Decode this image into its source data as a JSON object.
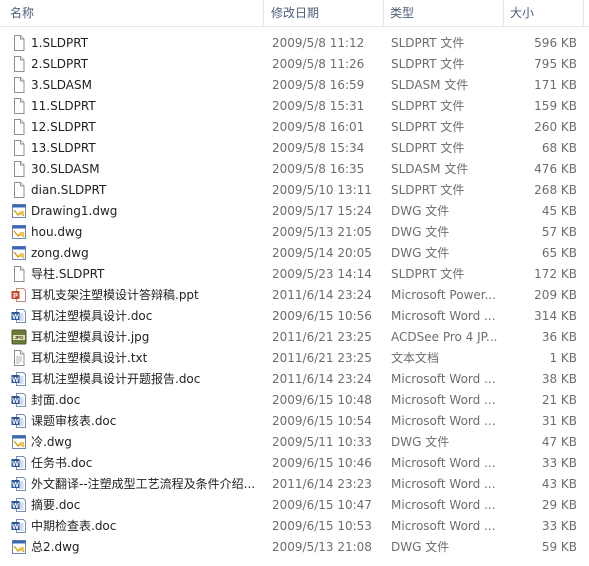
{
  "columns": {
    "name": "名称",
    "date": "修改日期",
    "type": "类型",
    "size": "大小"
  },
  "files": [
    {
      "name": "1.SLDPRT",
      "date": "2009/5/8 11:12",
      "type": "SLDPRT 文件",
      "size": "596 KB",
      "icon": "blank-file-icon"
    },
    {
      "name": "2.SLDPRT",
      "date": "2009/5/8 11:26",
      "type": "SLDPRT 文件",
      "size": "795 KB",
      "icon": "blank-file-icon"
    },
    {
      "name": "3.SLDASM",
      "date": "2009/5/8 16:59",
      "type": "SLDASM 文件",
      "size": "171 KB",
      "icon": "blank-file-icon"
    },
    {
      "name": "11.SLDPRT",
      "date": "2009/5/8 15:31",
      "type": "SLDPRT 文件",
      "size": "159 KB",
      "icon": "blank-file-icon"
    },
    {
      "name": "12.SLDPRT",
      "date": "2009/5/8 16:01",
      "type": "SLDPRT 文件",
      "size": "260 KB",
      "icon": "blank-file-icon"
    },
    {
      "name": "13.SLDPRT",
      "date": "2009/5/8 15:34",
      "type": "SLDPRT 文件",
      "size": "68 KB",
      "icon": "blank-file-icon"
    },
    {
      "name": "30.SLDASM",
      "date": "2009/5/8 16:35",
      "type": "SLDASM 文件",
      "size": "476 KB",
      "icon": "blank-file-icon"
    },
    {
      "name": "dian.SLDPRT",
      "date": "2009/5/10 13:11",
      "type": "SLDPRT 文件",
      "size": "268 KB",
      "icon": "blank-file-icon"
    },
    {
      "name": "Drawing1.dwg",
      "date": "2009/5/17 15:24",
      "type": "DWG 文件",
      "size": "45 KB",
      "icon": "dwg-file-icon"
    },
    {
      "name": "hou.dwg",
      "date": "2009/5/13 21:05",
      "type": "DWG 文件",
      "size": "57 KB",
      "icon": "dwg-file-icon"
    },
    {
      "name": "zong.dwg",
      "date": "2009/5/14 20:05",
      "type": "DWG 文件",
      "size": "65 KB",
      "icon": "dwg-file-icon"
    },
    {
      "name": "导柱.SLDPRT",
      "date": "2009/5/23 14:14",
      "type": "SLDPRT 文件",
      "size": "172 KB",
      "icon": "blank-file-icon"
    },
    {
      "name": "耳机支架注塑模设计答辩稿.ppt",
      "date": "2011/6/14 23:24",
      "type": "Microsoft Power...",
      "size": "209 KB",
      "icon": "ppt-file-icon"
    },
    {
      "name": "耳机注塑模具设计.doc",
      "date": "2009/6/15 10:56",
      "type": "Microsoft Word ...",
      "size": "314 KB",
      "icon": "word-file-icon"
    },
    {
      "name": "耳机注塑模具设计.jpg",
      "date": "2011/6/21 23:25",
      "type": "ACDSee Pro 4 JP...",
      "size": "36 KB",
      "icon": "jpg-file-icon"
    },
    {
      "name": "耳机注塑模具设计.txt",
      "date": "2011/6/21 23:25",
      "type": "文本文档",
      "size": "1 KB",
      "icon": "txt-file-icon"
    },
    {
      "name": "耳机注塑模具设计开题报告.doc",
      "date": "2011/6/14 23:24",
      "type": "Microsoft Word ...",
      "size": "38 KB",
      "icon": "word-file-icon"
    },
    {
      "name": "封面.doc",
      "date": "2009/6/15 10:48",
      "type": "Microsoft Word ...",
      "size": "21 KB",
      "icon": "word-file-icon"
    },
    {
      "name": "课题审核表.doc",
      "date": "2009/6/15 10:54",
      "type": "Microsoft Word ...",
      "size": "31 KB",
      "icon": "word-file-icon"
    },
    {
      "name": "冷.dwg",
      "date": "2009/5/11 10:33",
      "type": "DWG 文件",
      "size": "47 KB",
      "icon": "dwg-file-icon"
    },
    {
      "name": "任务书.doc",
      "date": "2009/6/15 10:46",
      "type": "Microsoft Word ...",
      "size": "33 KB",
      "icon": "word-file-icon"
    },
    {
      "name": "外文翻译--注塑成型工艺流程及条件介绍...",
      "date": "2011/6/14 23:23",
      "type": "Microsoft Word ...",
      "size": "43 KB",
      "icon": "word-file-icon"
    },
    {
      "name": "摘要.doc",
      "date": "2009/6/15 10:47",
      "type": "Microsoft Word ...",
      "size": "29 KB",
      "icon": "word-file-icon"
    },
    {
      "name": "中期检查表.doc",
      "date": "2009/6/15 10:53",
      "type": "Microsoft Word ...",
      "size": "33 KB",
      "icon": "word-file-icon"
    },
    {
      "name": "总2.dwg",
      "date": "2009/5/13 21:08",
      "type": "DWG 文件",
      "size": "59 KB",
      "icon": "dwg-file-icon"
    }
  ]
}
